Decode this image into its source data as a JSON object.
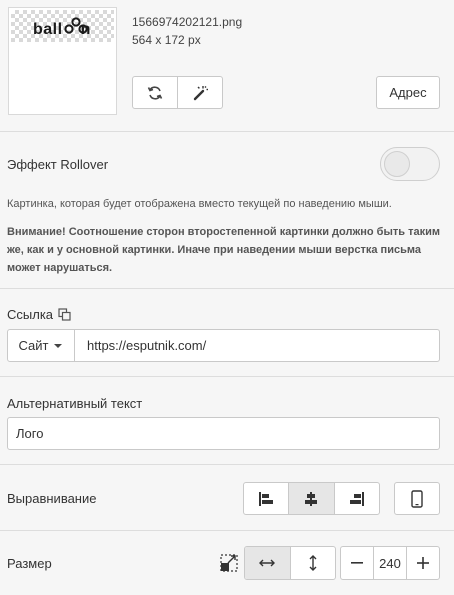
{
  "image": {
    "thumbnail_text": "ball",
    "thumbnail_text_tail": "n",
    "file_name": "1566974202121.png",
    "dimensions": "564 x 172 px",
    "address_button": "Адрес"
  },
  "rollover": {
    "label": "Эффект Rollover",
    "enabled": false,
    "description": "Картинка, которая будет отображена вместо текущей по наведению мыши.",
    "warning": "Внимание! Соотношение сторон второстепенной картинки должно быть таким же, как и у основной картинки. Иначе при наведении мыши верстка письма может нарушаться."
  },
  "link": {
    "label": "Ссылка",
    "type_label": "Сайт",
    "value": "https://esputnik.com/"
  },
  "alt": {
    "label": "Альтернативный текст",
    "value": "Лого"
  },
  "alignment": {
    "label": "Выравнивание",
    "options": [
      "left",
      "center",
      "right"
    ],
    "selected": "center"
  },
  "size": {
    "label": "Размер",
    "mode": "width",
    "value": "240"
  },
  "colors": {
    "background": "#f6f6f6",
    "border": "#c9c9c9",
    "active_segment": "#e6e6e6"
  }
}
